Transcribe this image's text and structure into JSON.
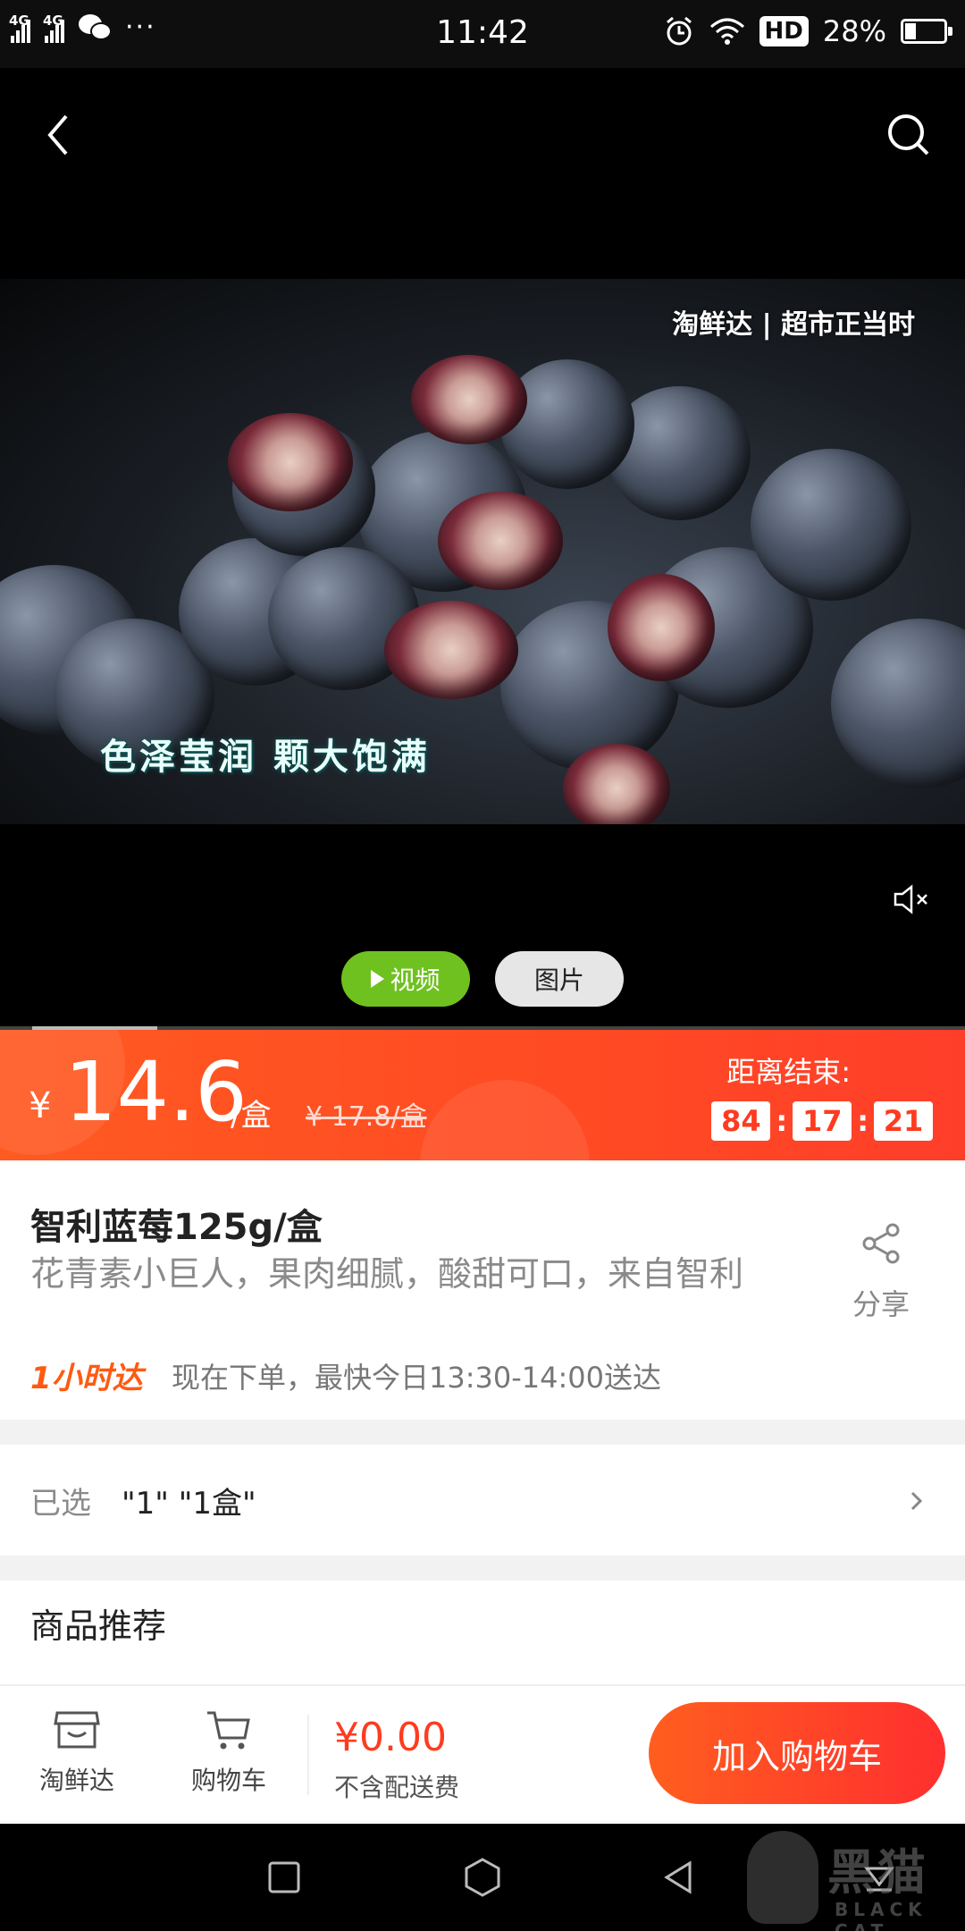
{
  "status_bar": {
    "network_1": "4G",
    "network_2": "4G",
    "more": "···",
    "time": "11:42",
    "hd": "HD",
    "battery": "28%",
    "battery_level": 0.28
  },
  "media": {
    "watermark": "淘鲜达 | 超市正当时",
    "caption": "色泽莹润 颗大饱满",
    "tabs": {
      "video": "视频",
      "images": "图片"
    },
    "video_progress": 0.13
  },
  "price": {
    "currency": "¥",
    "value": "14.6",
    "unit": "/盒",
    "original": "¥ 17.8/盒",
    "countdown_label": "距离结束:",
    "countdown": {
      "hours": "84",
      "minutes": "17",
      "seconds": "21"
    }
  },
  "product": {
    "title": "智利蓝莓125g/盒",
    "subtitle": "花青素小巨人，果肉细腻，酸甜可口，来自智利",
    "delivery_logo": "1小时达",
    "delivery_text": "现在下单，最快今日13:30-14:00送达",
    "share_label": "分享"
  },
  "selection": {
    "label": "已选",
    "value": "\"1\" \"1盒\""
  },
  "recommend": {
    "title": "商品推荐"
  },
  "bottom_bar": {
    "store_label": "淘鲜达",
    "cart_label": "购物车",
    "total": "¥0.00",
    "shipping_note": "不含配送费",
    "add_to_cart": "加入购物车"
  },
  "watermark_logo": {
    "brand": "黑猫",
    "brand_en": "BLACK CAT"
  },
  "colors": {
    "accent": "#ff4a23",
    "video_tab": "#6fc11f",
    "price_text": "#ff3b1f"
  }
}
